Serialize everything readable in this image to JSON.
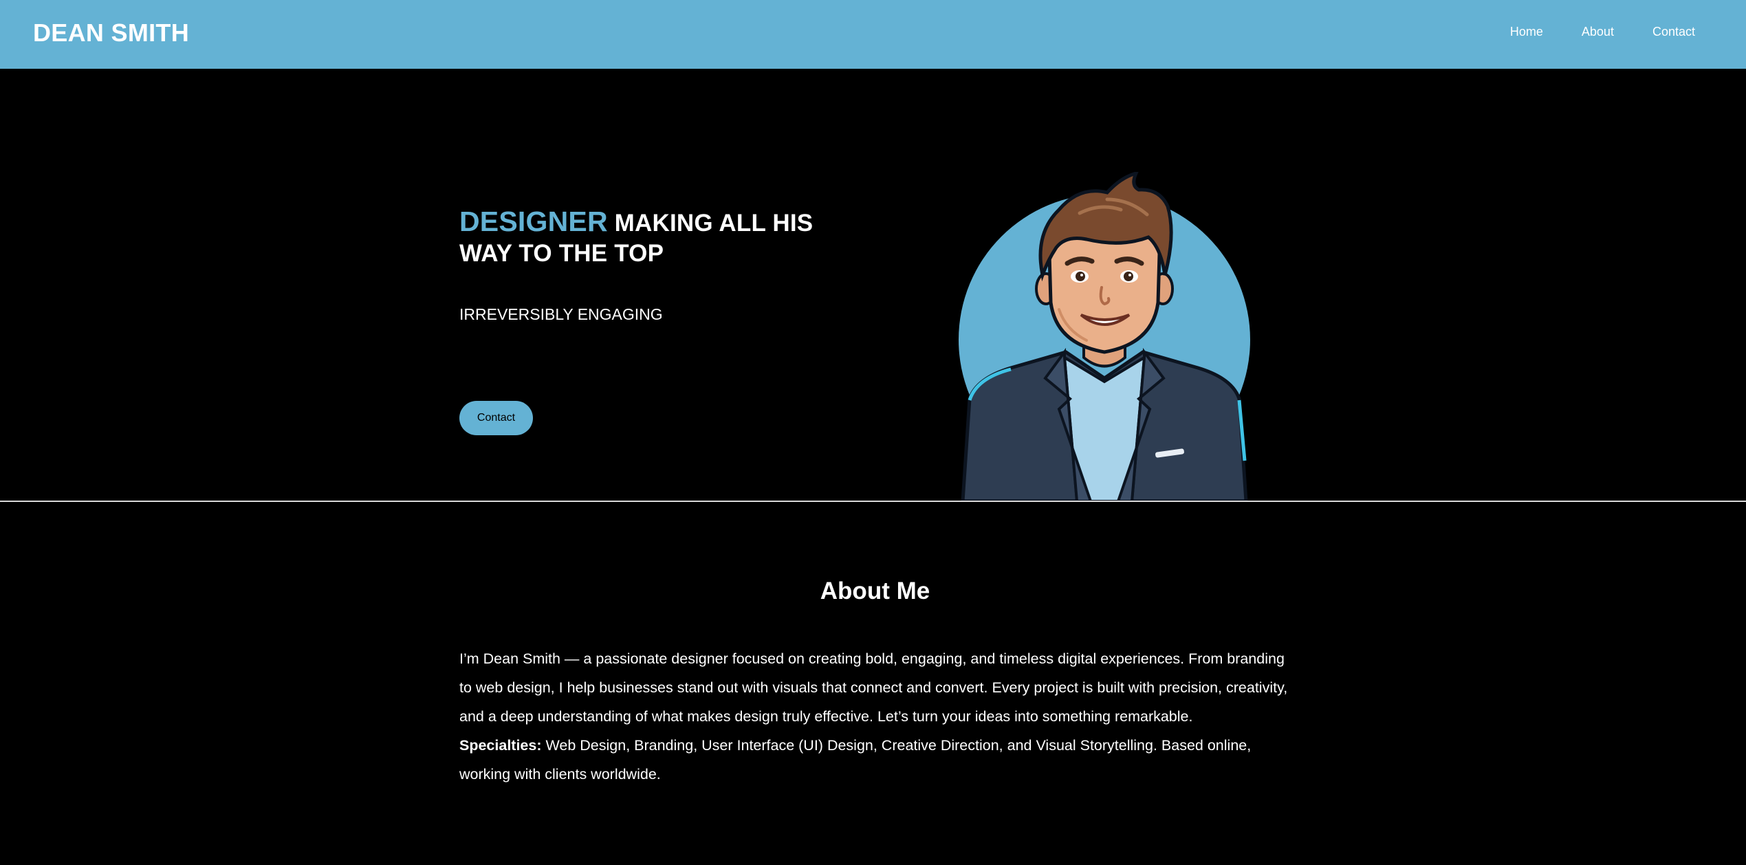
{
  "header": {
    "brand": "DEAN SMITH",
    "nav": [
      "Home",
      "About",
      "Contact"
    ],
    "background": "#64b2d4"
  },
  "hero": {
    "title_accent": "DESIGNER",
    "title_rest": " MAKING ALL HIS WAY TO THE TOP",
    "subtitle": "IRREVERSIBLY ENGAGING",
    "button_label": "Contact",
    "accent_color": "#64b2d4",
    "avatar": "cartoon-man-avatar"
  },
  "about": {
    "title": "About Me",
    "paragraph": "I’m Dean Smith — a passionate designer focused on creating bold, engaging, and timeless digital experiences. From branding to web design, I help businesses stand out with visuals that connect and convert. Every project is built with precision, creativity, and a deep understanding of what makes design truly effective. Let’s turn your ideas into something remarkable.",
    "specialties_label": "Specialties:",
    "specialties_text": " Web Design, Branding, User Interface (UI) Design, Creative Direction, and Visual Storytelling. Based online, working with clients worldwide."
  }
}
